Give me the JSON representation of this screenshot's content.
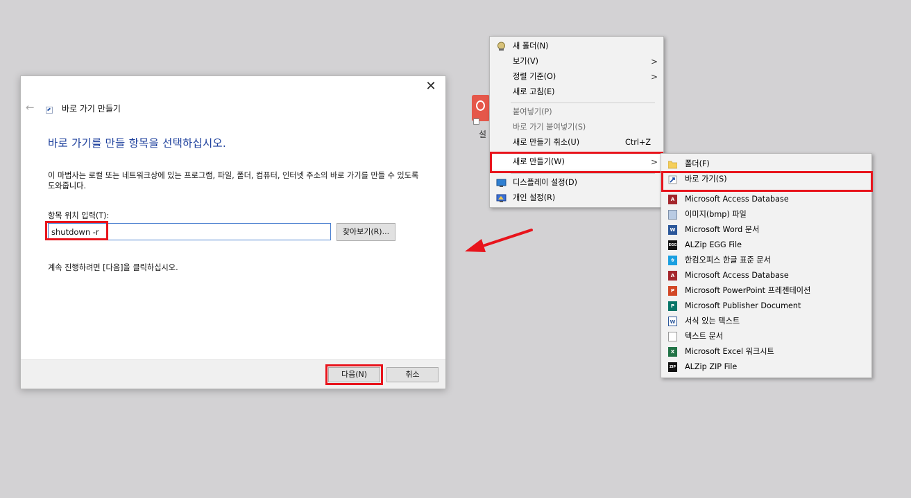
{
  "wizard": {
    "title": "바로 가기 만들기",
    "heading": "바로 가기를 만들 항목을 선택하십시오.",
    "description": "이 마법사는 로컬 또는 네트워크상에 있는 프로그램, 파일, 폴더, 컴퓨터, 인터넷 주소의 바로 가기를 만들 수 있도록 도와줍니다.",
    "location_label": "항목 위치 입력(T):",
    "location_value": "shutdown -r",
    "browse_label": "찾아보기(R)...",
    "continue_text": "계속 진행하려면 [다음]을 클릭하십시오.",
    "next_label": "다음(N)",
    "cancel_label": "취소",
    "close_glyph": "✕",
    "back_glyph": "←"
  },
  "desktop_icon": {
    "label": "설"
  },
  "context_menu": {
    "new_folder": "새 폴더(N)",
    "view": "보기(V)",
    "sort": "정렬 기준(O)",
    "refresh": "새로 고침(E)",
    "paste": "붙여넣기(P)",
    "paste_shortcut": "바로 가기 붙여넣기(S)",
    "undo_new": "새로 만들기 취소(U)",
    "undo_shortcut": "Ctrl+Z",
    "new": "새로 만들기(W)",
    "display": "디스플레이 설정(D)",
    "personalize": "개인 설정(R)",
    "arrow_glyph": ">"
  },
  "submenu": {
    "items": [
      "폴더(F)",
      "바로 가기(S)",
      "Microsoft Access Database",
      "이미지(bmp) 파일",
      "Microsoft Word 문서",
      "ALZip EGG File",
      "한컴오피스 한글 표준 문서",
      "Microsoft Access Database",
      "Microsoft PowerPoint 프레젠테이션",
      "Microsoft Publisher Document",
      "서식 있는 텍스트",
      "텍스트 문서",
      "Microsoft Excel 워크시트",
      "ALZip ZIP File"
    ],
    "icon_text": {
      "egg": "EGG",
      "zip": "ZIP"
    }
  },
  "colors": {
    "highlight_box": "#e8141c",
    "heading_blue": "#1c3f9c",
    "desktop_bg": "#d3d2d4"
  }
}
